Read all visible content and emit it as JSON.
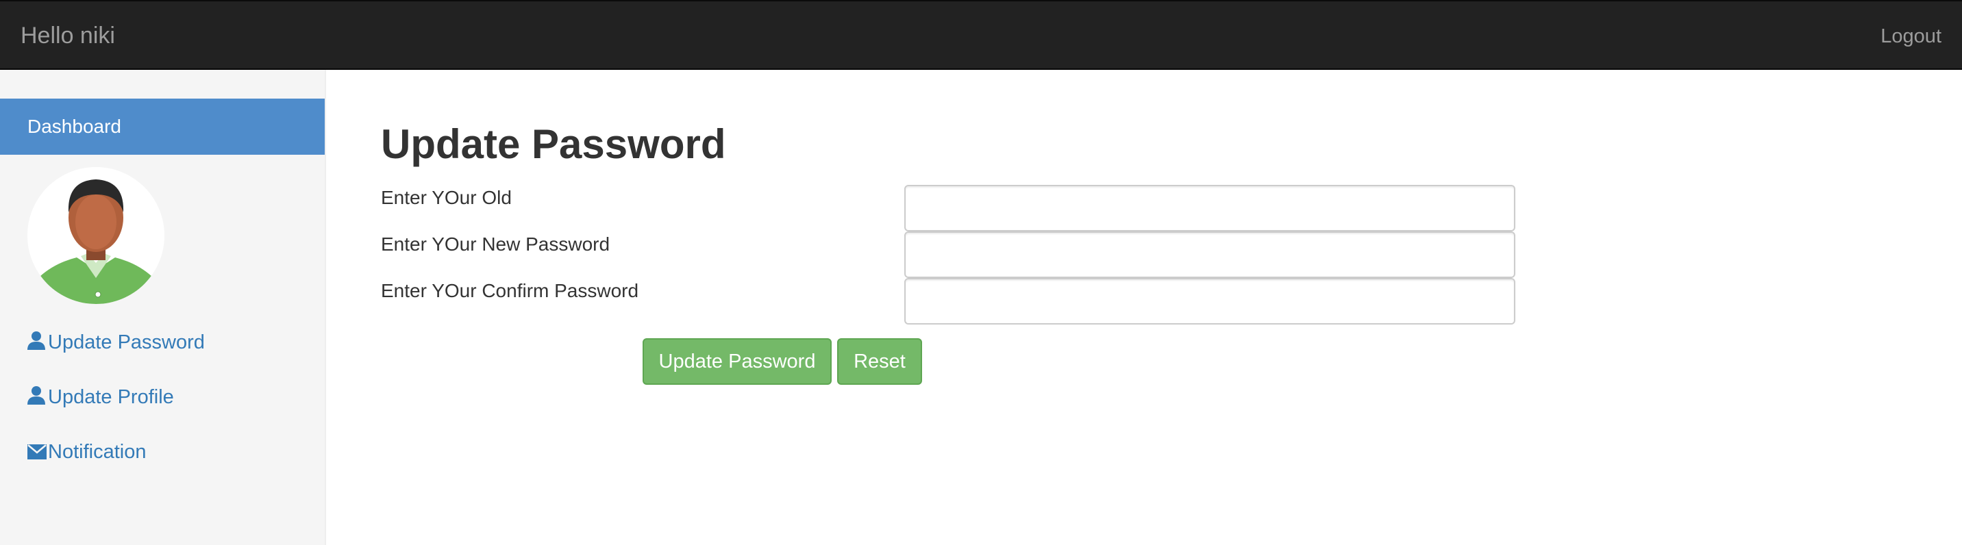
{
  "header": {
    "brand": "Hello niki",
    "logout_label": "Logout"
  },
  "sidebar": {
    "active_label": "Dashboard",
    "avatar_alt": "user avatar",
    "links": [
      {
        "label": "Update Password",
        "icon": "user-icon"
      },
      {
        "label": "Update Profile",
        "icon": "user-icon"
      },
      {
        "label": "Notification",
        "icon": "envelope-icon"
      }
    ]
  },
  "main": {
    "title": "Update Password",
    "fields": [
      {
        "label": "Enter YOur Old",
        "value": ""
      },
      {
        "label": "Enter YOur New Password",
        "value": ""
      },
      {
        "label": "Enter YOur Confirm Password",
        "value": ""
      }
    ],
    "buttons": {
      "update_label": "Update Password",
      "reset_label": "Reset"
    }
  },
  "colors": {
    "navbar_bg": "#222222",
    "sidebar_active": "#4f8ccb",
    "link": "#337ab7",
    "button_green": "#74b968"
  }
}
